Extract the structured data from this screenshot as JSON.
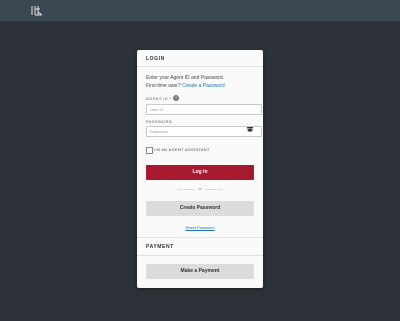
{
  "header": {
    "logo_icon": "brand-logo-icon"
  },
  "login": {
    "title": "LOGIN",
    "intro_line1": "Enter your Agent ID and Password.",
    "intro_line2_prefix": "First-time user?",
    "create_password_link": "Create a Password",
    "agent_id_label": "AGENT ID *",
    "agent_id_placeholder": "User ID",
    "password_label": "PASSWORD",
    "password_placeholder": "Password",
    "assistant_checkbox_label": "I'M AN AGENT ASSISTANT",
    "assistant_checked": false,
    "login_button": "Log In",
    "or_text": "or",
    "create_password_button": "Create Password",
    "reset_password_link": "Reset Password"
  },
  "payment": {
    "title": "PAYMENT",
    "make_payment_button": "Make a Payment"
  },
  "colors": {
    "background": "#2c3237",
    "topbar": "#3a4650",
    "primary_button": "#a6192e",
    "secondary_button": "#dcdcdc",
    "link": "#1a73b8"
  }
}
